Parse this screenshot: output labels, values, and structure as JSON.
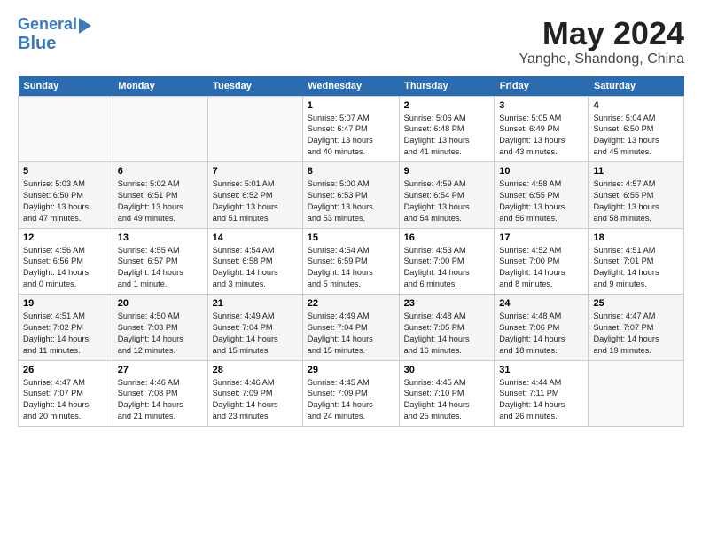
{
  "header": {
    "logo_line1": "General",
    "logo_line2": "Blue",
    "month_title": "May 2024",
    "location": "Yanghe, Shandong, China"
  },
  "days_of_week": [
    "Sunday",
    "Monday",
    "Tuesday",
    "Wednesday",
    "Thursday",
    "Friday",
    "Saturday"
  ],
  "weeks": [
    [
      {
        "num": "",
        "info": ""
      },
      {
        "num": "",
        "info": ""
      },
      {
        "num": "",
        "info": ""
      },
      {
        "num": "1",
        "info": "Sunrise: 5:07 AM\nSunset: 6:47 PM\nDaylight: 13 hours\nand 40 minutes."
      },
      {
        "num": "2",
        "info": "Sunrise: 5:06 AM\nSunset: 6:48 PM\nDaylight: 13 hours\nand 41 minutes."
      },
      {
        "num": "3",
        "info": "Sunrise: 5:05 AM\nSunset: 6:49 PM\nDaylight: 13 hours\nand 43 minutes."
      },
      {
        "num": "4",
        "info": "Sunrise: 5:04 AM\nSunset: 6:50 PM\nDaylight: 13 hours\nand 45 minutes."
      }
    ],
    [
      {
        "num": "5",
        "info": "Sunrise: 5:03 AM\nSunset: 6:50 PM\nDaylight: 13 hours\nand 47 minutes."
      },
      {
        "num": "6",
        "info": "Sunrise: 5:02 AM\nSunset: 6:51 PM\nDaylight: 13 hours\nand 49 minutes."
      },
      {
        "num": "7",
        "info": "Sunrise: 5:01 AM\nSunset: 6:52 PM\nDaylight: 13 hours\nand 51 minutes."
      },
      {
        "num": "8",
        "info": "Sunrise: 5:00 AM\nSunset: 6:53 PM\nDaylight: 13 hours\nand 53 minutes."
      },
      {
        "num": "9",
        "info": "Sunrise: 4:59 AM\nSunset: 6:54 PM\nDaylight: 13 hours\nand 54 minutes."
      },
      {
        "num": "10",
        "info": "Sunrise: 4:58 AM\nSunset: 6:55 PM\nDaylight: 13 hours\nand 56 minutes."
      },
      {
        "num": "11",
        "info": "Sunrise: 4:57 AM\nSunset: 6:55 PM\nDaylight: 13 hours\nand 58 minutes."
      }
    ],
    [
      {
        "num": "12",
        "info": "Sunrise: 4:56 AM\nSunset: 6:56 PM\nDaylight: 14 hours\nand 0 minutes."
      },
      {
        "num": "13",
        "info": "Sunrise: 4:55 AM\nSunset: 6:57 PM\nDaylight: 14 hours\nand 1 minute."
      },
      {
        "num": "14",
        "info": "Sunrise: 4:54 AM\nSunset: 6:58 PM\nDaylight: 14 hours\nand 3 minutes."
      },
      {
        "num": "15",
        "info": "Sunrise: 4:54 AM\nSunset: 6:59 PM\nDaylight: 14 hours\nand 5 minutes."
      },
      {
        "num": "16",
        "info": "Sunrise: 4:53 AM\nSunset: 7:00 PM\nDaylight: 14 hours\nand 6 minutes."
      },
      {
        "num": "17",
        "info": "Sunrise: 4:52 AM\nSunset: 7:00 PM\nDaylight: 14 hours\nand 8 minutes."
      },
      {
        "num": "18",
        "info": "Sunrise: 4:51 AM\nSunset: 7:01 PM\nDaylight: 14 hours\nand 9 minutes."
      }
    ],
    [
      {
        "num": "19",
        "info": "Sunrise: 4:51 AM\nSunset: 7:02 PM\nDaylight: 14 hours\nand 11 minutes."
      },
      {
        "num": "20",
        "info": "Sunrise: 4:50 AM\nSunset: 7:03 PM\nDaylight: 14 hours\nand 12 minutes."
      },
      {
        "num": "21",
        "info": "Sunrise: 4:49 AM\nSunset: 7:04 PM\nDaylight: 14 hours\nand 15 minutes."
      },
      {
        "num": "22",
        "info": "Sunrise: 4:49 AM\nSunset: 7:04 PM\nDaylight: 14 hours\nand 15 minutes."
      },
      {
        "num": "23",
        "info": "Sunrise: 4:48 AM\nSunset: 7:05 PM\nDaylight: 14 hours\nand 16 minutes."
      },
      {
        "num": "24",
        "info": "Sunrise: 4:48 AM\nSunset: 7:06 PM\nDaylight: 14 hours\nand 18 minutes."
      },
      {
        "num": "25",
        "info": "Sunrise: 4:47 AM\nSunset: 7:07 PM\nDaylight: 14 hours\nand 19 minutes."
      }
    ],
    [
      {
        "num": "26",
        "info": "Sunrise: 4:47 AM\nSunset: 7:07 PM\nDaylight: 14 hours\nand 20 minutes."
      },
      {
        "num": "27",
        "info": "Sunrise: 4:46 AM\nSunset: 7:08 PM\nDaylight: 14 hours\nand 21 minutes."
      },
      {
        "num": "28",
        "info": "Sunrise: 4:46 AM\nSunset: 7:09 PM\nDaylight: 14 hours\nand 23 minutes."
      },
      {
        "num": "29",
        "info": "Sunrise: 4:45 AM\nSunset: 7:09 PM\nDaylight: 14 hours\nand 24 minutes."
      },
      {
        "num": "30",
        "info": "Sunrise: 4:45 AM\nSunset: 7:10 PM\nDaylight: 14 hours\nand 25 minutes."
      },
      {
        "num": "31",
        "info": "Sunrise: 4:44 AM\nSunset: 7:11 PM\nDaylight: 14 hours\nand 26 minutes."
      },
      {
        "num": "",
        "info": ""
      }
    ]
  ]
}
